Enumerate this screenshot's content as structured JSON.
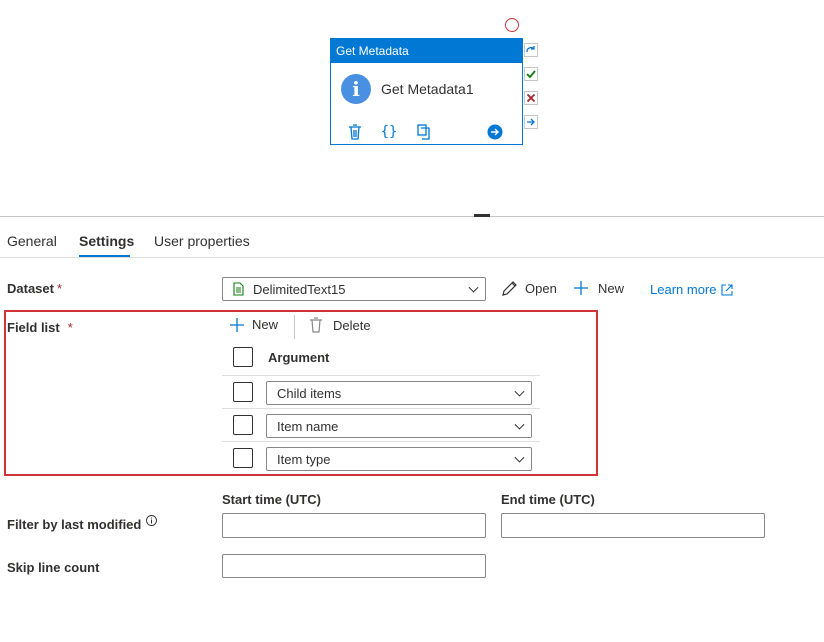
{
  "activity": {
    "header": "Get Metadata",
    "name": "Get Metadata1"
  },
  "tabs": [
    {
      "label": "General"
    },
    {
      "label": "Settings"
    },
    {
      "label": "User properties"
    }
  ],
  "dataset": {
    "label": "Dataset",
    "required_mark": "*",
    "value": "DelimitedText15",
    "open_label": "Open",
    "new_label": "New",
    "learn_more_label": "Learn more"
  },
  "field_list": {
    "label": "Field list",
    "required_mark": "*",
    "new_label": "New",
    "delete_label": "Delete",
    "column_header": "Argument",
    "rows": [
      {
        "value": "Child items"
      },
      {
        "value": "Item name"
      },
      {
        "value": "Item type"
      }
    ]
  },
  "filter": {
    "label": "Filter by last modified",
    "start_label": "Start time (UTC)",
    "end_label": "End time (UTC)",
    "start_value": "",
    "end_value": ""
  },
  "skip": {
    "label": "Skip line count",
    "value": ""
  },
  "colors": {
    "accent": "#0078d4",
    "error": "#d13438",
    "success": "#107c10"
  }
}
